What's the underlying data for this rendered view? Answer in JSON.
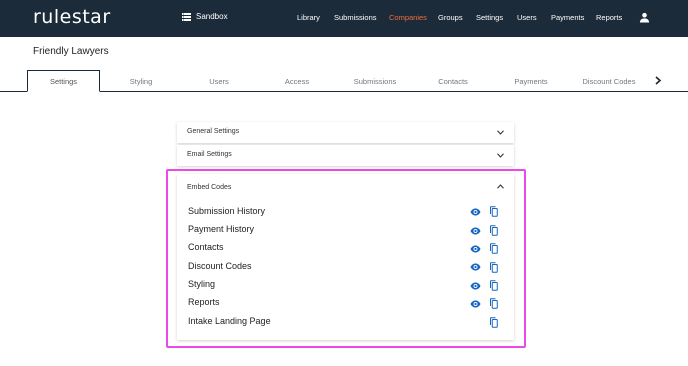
{
  "header": {
    "logo": "rulestar",
    "sandbox_label": "Sandbox",
    "nav": [
      {
        "label": "Library",
        "active": false
      },
      {
        "label": "Submissions",
        "active": false
      },
      {
        "label": "Companies",
        "active": true
      },
      {
        "label": "Groups",
        "active": false
      },
      {
        "label": "Settings",
        "active": false
      },
      {
        "label": "Users",
        "active": false
      },
      {
        "label": "Payments",
        "active": false
      },
      {
        "label": "Reports",
        "active": false
      }
    ],
    "user_icon": "person-icon"
  },
  "page": {
    "title": "Friendly Lawyers"
  },
  "tabs": [
    {
      "label": "Settings",
      "active": true
    },
    {
      "label": "Styling",
      "active": false
    },
    {
      "label": "Users",
      "active": false
    },
    {
      "label": "Access",
      "active": false
    },
    {
      "label": "Submissions",
      "active": false
    },
    {
      "label": "Contacts",
      "active": false
    },
    {
      "label": "Payments",
      "active": false
    },
    {
      "label": "Discount Codes",
      "active": false
    }
  ],
  "accordion": {
    "general_settings": {
      "label": "General Settings",
      "expanded": false
    },
    "email_settings": {
      "label": "Email Settings",
      "expanded": false
    },
    "embed_codes": {
      "label": "Embed Codes",
      "expanded": true,
      "items": [
        {
          "label": "Submission History",
          "preview": true,
          "copy": true
        },
        {
          "label": "Payment History",
          "preview": true,
          "copy": true
        },
        {
          "label": "Contacts",
          "preview": true,
          "copy": true
        },
        {
          "label": "Discount Codes",
          "preview": true,
          "copy": true
        },
        {
          "label": "Styling",
          "preview": true,
          "copy": true
        },
        {
          "label": "Reports",
          "preview": true,
          "copy": true
        },
        {
          "label": "Intake Landing Page",
          "preview": false,
          "copy": true
        }
      ]
    }
  },
  "colors": {
    "topbar": "#1c2b3a",
    "active_nav": "#ef6d3b",
    "icon_blue": "#1565c0",
    "highlight": "#ea4ae8"
  }
}
